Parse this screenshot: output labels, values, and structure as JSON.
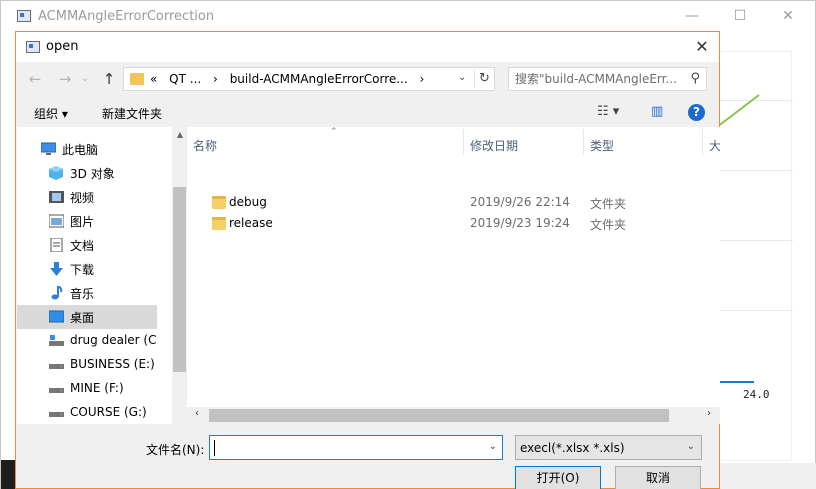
{
  "main_window": {
    "title": "ACMMAngleErrorCorrection",
    "controls": {
      "minimize": "—",
      "maximize": "☐",
      "close": "✕"
    },
    "chart_tick": "24.0"
  },
  "dialog": {
    "title": "open",
    "close": "✕",
    "address": {
      "crumbs": [
        "«",
        "QT ...",
        "›",
        "build-ACMMAngleErrorCorre...",
        "›"
      ],
      "dropdown": "⌄",
      "refresh": "↻"
    },
    "search_placeholder": "搜索\"build-ACMMAngleErr...",
    "toolbar": {
      "organize": "组织 ▾",
      "new_folder": "新建文件夹",
      "view": "☷ ▾",
      "pane": "▥",
      "help": "?"
    },
    "nav": {
      "root": "此电脑",
      "items": [
        "3D 对象",
        "视频",
        "图片",
        "文档",
        "下载",
        "音乐",
        "桌面",
        "drug dealer (C",
        "BUSINESS (E:)",
        "MINE (F:)",
        "COURSE (G:)"
      ],
      "selected": "桌面"
    },
    "columns": {
      "name": "名称",
      "modified": "修改日期",
      "type": "类型",
      "size": "大小"
    },
    "files": [
      {
        "name": "debug",
        "modified": "2019/9/26 22:14",
        "type": "文件夹"
      },
      {
        "name": "release",
        "modified": "2019/9/23 19:24",
        "type": "文件夹"
      }
    ],
    "filename_label": "文件名(N):",
    "filename_value": "",
    "filter_value": "execl(*.xlsx *.xls)",
    "open_button": "打开(O)",
    "cancel_button": "取消"
  }
}
